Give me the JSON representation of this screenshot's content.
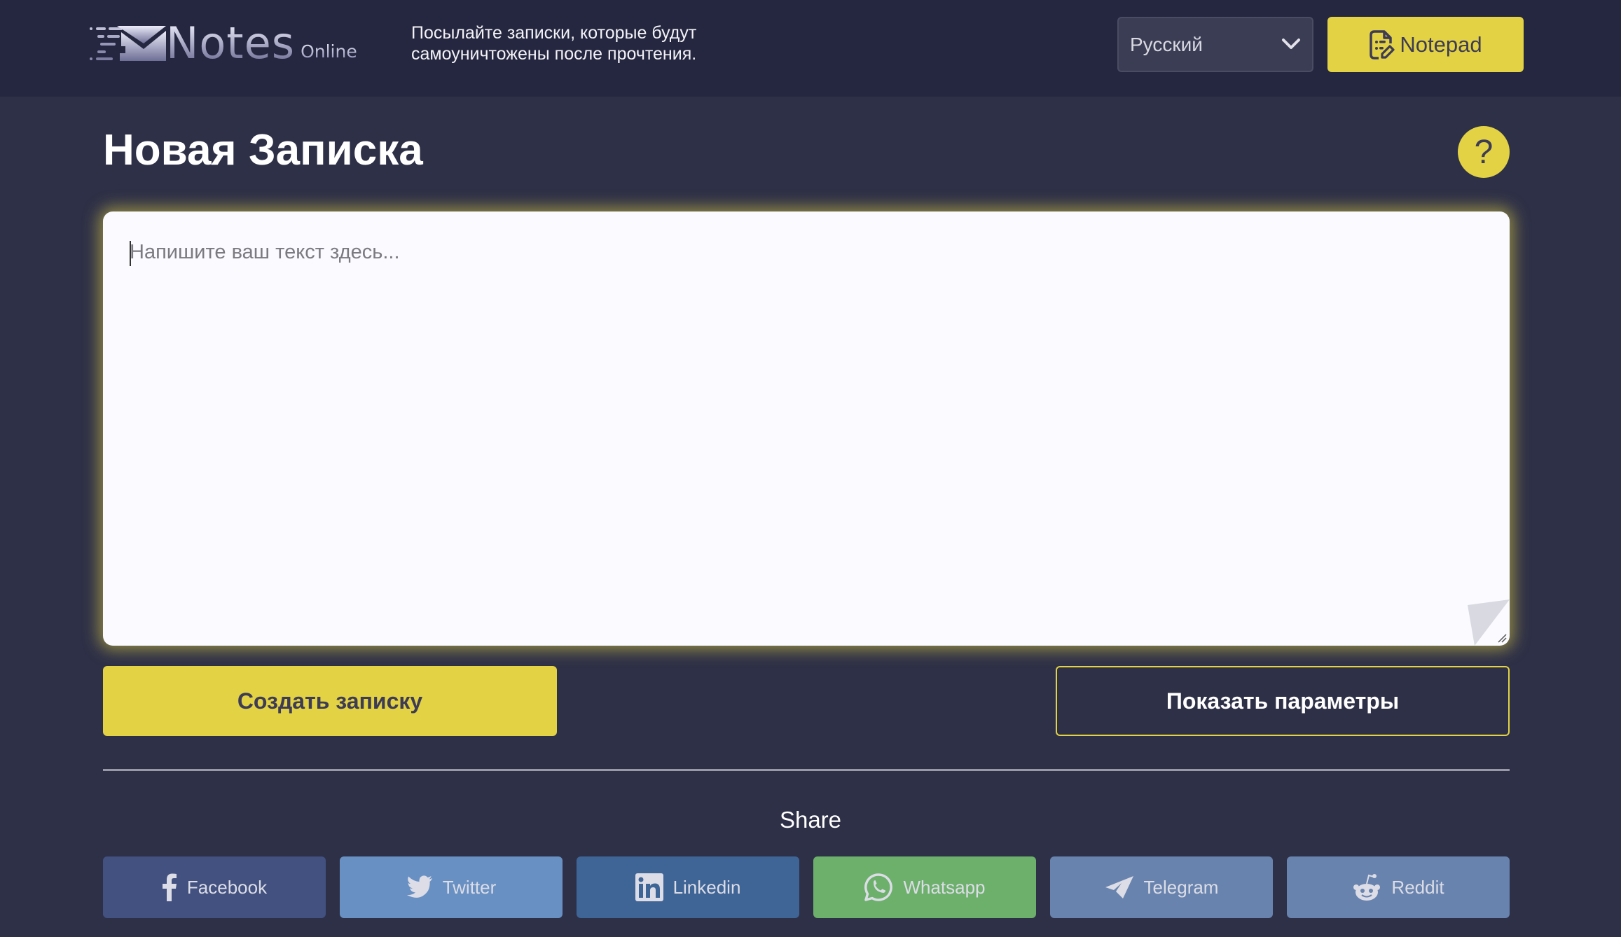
{
  "header": {
    "logo_word": "Notes",
    "logo_sub": "Online",
    "tagline_line1": "Посылайте записки, которые будут",
    "tagline_line2": "самоуничтожены после прочтения.",
    "language_select": {
      "value": "Русский",
      "icon": "chevron-down-icon"
    },
    "notepad_button": {
      "label": "Notepad",
      "icon": "document-edit-icon"
    }
  },
  "main": {
    "title": "Новая Записка",
    "help_button": {
      "label": "?",
      "icon": "question-icon"
    },
    "note_input": {
      "value": "",
      "placeholder": "Напишите ваш текст здесь..."
    },
    "create_button": "Создать записку",
    "show_params_button": "Показать параметры"
  },
  "share": {
    "label": "Share",
    "buttons": [
      {
        "label": "Facebook",
        "icon": "facebook-icon",
        "color": "#425180"
      },
      {
        "label": "Twitter",
        "icon": "twitter-icon",
        "color": "#6890c3"
      },
      {
        "label": "Linkedin",
        "icon": "linkedin-icon",
        "color": "#3f6496"
      },
      {
        "label": "Whatsapp",
        "icon": "whatsapp-icon",
        "color": "#6cb06b"
      },
      {
        "label": "Telegram",
        "icon": "telegram-icon",
        "color": "#6883ae"
      },
      {
        "label": "Reddit",
        "icon": "reddit-icon",
        "color": "#6883ae"
      }
    ]
  },
  "colors": {
    "header_bg": "#252740",
    "page_bg": "#2e3047",
    "accent": "#e2d244",
    "accent_text": "#3d3b55"
  }
}
